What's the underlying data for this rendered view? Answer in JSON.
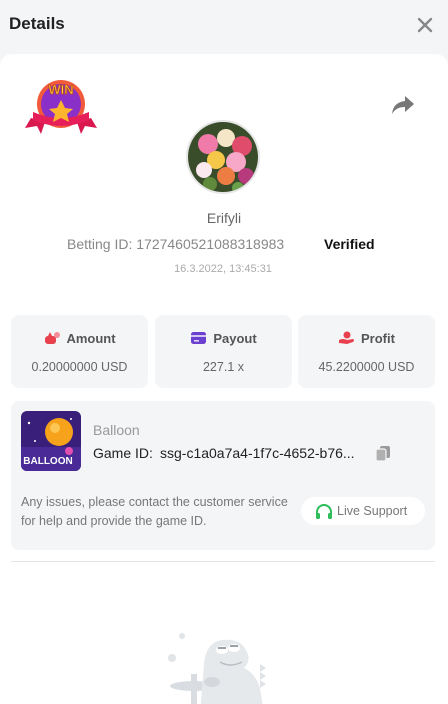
{
  "header": {
    "title": "Details",
    "close_icon": "close-icon"
  },
  "bet": {
    "badge_text": "WIN",
    "share_icon": "share-icon",
    "username": "Erifyli",
    "betting_id": "Betting ID: 1727460521088318983",
    "verified_label": "Verified",
    "timestamp": "16.3.2022, 13:45:31"
  },
  "stats": {
    "amount": {
      "label": "Amount",
      "value": "0.20000000 USD",
      "icon": "money-bag-icon"
    },
    "payout": {
      "label": "Payout",
      "value": "227.1 x",
      "icon": "card-icon"
    },
    "profit": {
      "label": "Profit",
      "value": "45.2200000 USD",
      "icon": "hand-coin-icon"
    }
  },
  "game": {
    "thumb_label": "BALLOON",
    "name": "Balloon",
    "id_label": "Game ID:",
    "id_value": "ssg-c1a0a7a4-1f7c-4652-b76...",
    "copy_icon": "copy-icon",
    "issues_text": "Any issues, please contact the customer service for help and provide the game ID.",
    "support_label": "Live Support",
    "support_icon": "headset-icon"
  },
  "colors": {
    "accent_red": "#e8414d",
    "accent_purple": "#6b3fcf",
    "support_green": "#2ebd5b",
    "background": "#f4f5f7"
  }
}
